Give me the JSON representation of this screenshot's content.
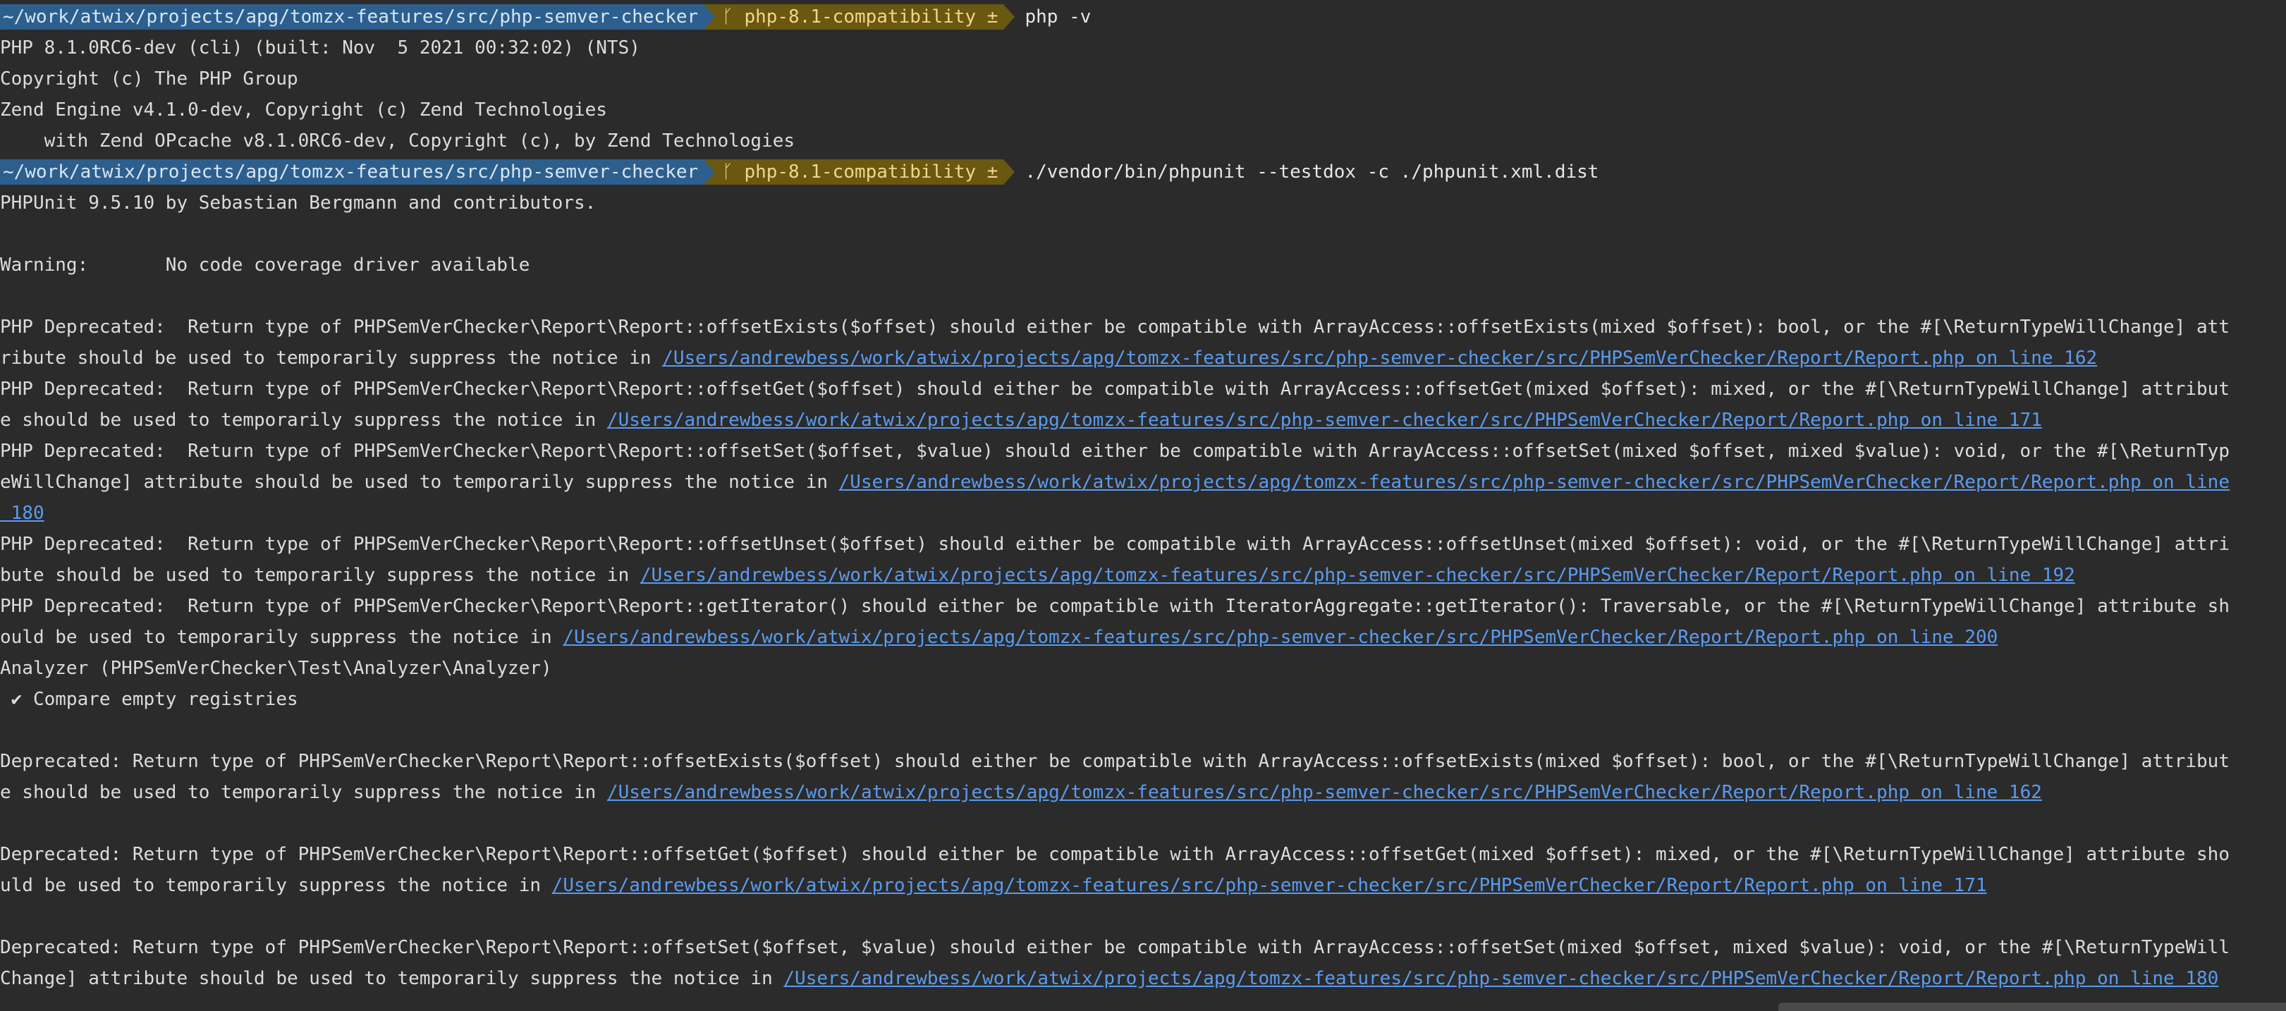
{
  "prompt": {
    "path": "~/work/atwix/projects/apg/tomzx-features/src/php-semver-checker",
    "git_icon": "branch-icon",
    "git_branch": "php-8.1-compatibility ±"
  },
  "commands": {
    "first": "php -v",
    "second": "./vendor/bin/phpunit --testdox -c ./phpunit.xml.dist"
  },
  "php_version": [
    "PHP 8.1.0RC6-dev (cli) (built: Nov  5 2021 00:32:02) (NTS)",
    "Copyright (c) The PHP Group",
    "Zend Engine v4.1.0-dev, Copyright (c) Zend Technologies",
    "    with Zend OPcache v8.1.0RC6-dev, Copyright (c), by Zend Technologies"
  ],
  "phpunit_header": "PHPUnit 9.5.10 by Sebastian Bergmann and contributors.",
  "warning": "Warning:       No code coverage driver available",
  "deprecations_top": [
    {
      "line1": "PHP Deprecated:  Return type of PHPSemVerChecker\\Report\\Report::offsetExists($offset) should either be compatible with ArrayAccess::offsetExists(mixed $offset): bool, or the #[\\ReturnTypeWillChange] att",
      "line2": "ribute should be used to temporarily suppress the notice in ",
      "link": "/Users/andrewbess/work/atwix/projects/apg/tomzx-features/src/php-semver-checker/src/PHPSemVerChecker/Report/Report.php on line 162"
    },
    {
      "line1": "PHP Deprecated:  Return type of PHPSemVerChecker\\Report\\Report::offsetGet($offset) should either be compatible with ArrayAccess::offsetGet(mixed $offset): mixed, or the #[\\ReturnTypeWillChange] attribut",
      "line2": "e should be used to temporarily suppress the notice in ",
      "link": "/Users/andrewbess/work/atwix/projects/apg/tomzx-features/src/php-semver-checker/src/PHPSemVerChecker/Report/Report.php on line 171"
    }
  ],
  "dep_offsetset": {
    "line1": "PHP Deprecated:  Return type of PHPSemVerChecker\\Report\\Report::offsetSet($offset, $value) should either be compatible with ArrayAccess::offsetSet(mixed $offset, mixed $value): void, or the #[\\ReturnTyp",
    "line2": "eWillChange] attribute should be used to temporarily suppress the notice in ",
    "link_a": "/Users/andrewbess/work/atwix/projects/apg/tomzx-features/src/php-semver-checker/src/PHPSemVerChecker/Report/Report.php on line",
    "link_b": " 180"
  },
  "deprecations_mid": [
    {
      "line1": "PHP Deprecated:  Return type of PHPSemVerChecker\\Report\\Report::offsetUnset($offset) should either be compatible with ArrayAccess::offsetUnset(mixed $offset): void, or the #[\\ReturnTypeWillChange] attri",
      "line2": "bute should be used to temporarily suppress the notice in ",
      "link": "/Users/andrewbess/work/atwix/projects/apg/tomzx-features/src/php-semver-checker/src/PHPSemVerChecker/Report/Report.php on line 192"
    },
    {
      "line1": "PHP Deprecated:  Return type of PHPSemVerChecker\\Report\\Report::getIterator() should either be compatible with IteratorAggregate::getIterator(): Traversable, or the #[\\ReturnTypeWillChange] attribute sh",
      "line2": "ould be used to temporarily suppress the notice in ",
      "link": "/Users/andrewbess/work/atwix/projects/apg/tomzx-features/src/php-semver-checker/src/PHPSemVerChecker/Report/Report.php on line 200"
    }
  ],
  "analyzer": "Analyzer (PHPSemVerChecker\\Test\\Analyzer\\Analyzer)",
  "test_result": " ✔ Compare empty registries",
  "deprecations_bottom": [
    {
      "line1": "Deprecated: Return type of PHPSemVerChecker\\Report\\Report::offsetExists($offset) should either be compatible with ArrayAccess::offsetExists(mixed $offset): bool, or the #[\\ReturnTypeWillChange] attribut",
      "line2": "e should be used to temporarily suppress the notice in ",
      "link": "/Users/andrewbess/work/atwix/projects/apg/tomzx-features/src/php-semver-checker/src/PHPSemVerChecker/Report/Report.php on line 162"
    },
    {
      "line1": "Deprecated: Return type of PHPSemVerChecker\\Report\\Report::offsetGet($offset) should either be compatible with ArrayAccess::offsetGet(mixed $offset): mixed, or the #[\\ReturnTypeWillChange] attribute sho",
      "line2": "uld be used to temporarily suppress the notice in ",
      "link": "/Users/andrewbess/work/atwix/projects/apg/tomzx-features/src/php-semver-checker/src/PHPSemVerChecker/Report/Report.php on line 171"
    },
    {
      "line1": "Deprecated: Return type of PHPSemVerChecker\\Report\\Report::offsetSet($offset, $value) should either be compatible with ArrayAccess::offsetSet(mixed $offset, mixed $value): void, or the #[\\ReturnTypeWill",
      "line2": "Change] attribute should be used to temporarily suppress the notice in ",
      "link": "/Users/andrewbess/work/atwix/projects/apg/tomzx-features/src/php-semver-checker/src/PHPSemVerChecker/Report/Report.php on line 180"
    }
  ],
  "colors": {
    "background": "#2b2b2b",
    "text": "#dcdcdc",
    "path_segment": "#2d5f8e",
    "git_segment": "#6a5710",
    "link": "#5a9bf0"
  }
}
